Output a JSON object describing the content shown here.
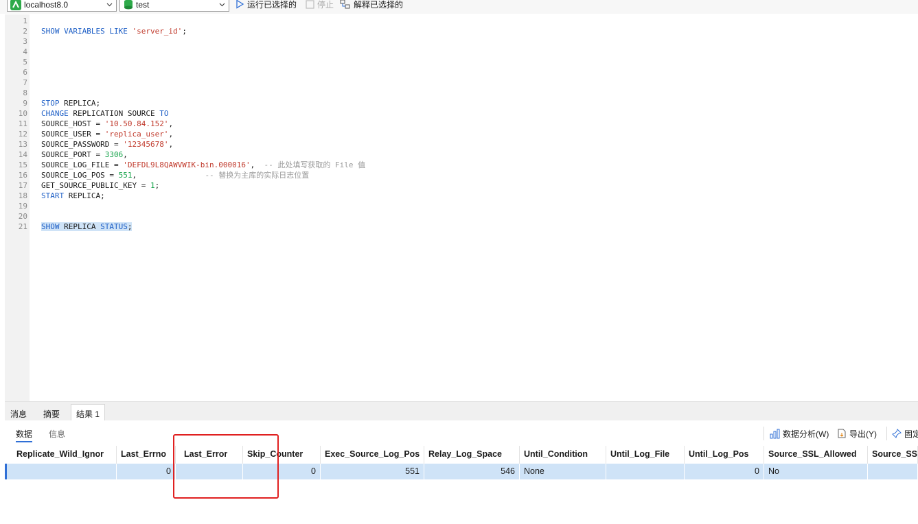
{
  "toolbar": {
    "connection": "localhost8.0",
    "database": "test",
    "run_selected": "运行已选择的",
    "stop": "停止",
    "explain_selected": "解释已选择的"
  },
  "editor": {
    "line_numbers": [
      "1",
      "2",
      "3",
      "4",
      "5",
      "6",
      "7",
      "8",
      "9",
      "10",
      "11",
      "12",
      "13",
      "14",
      "15",
      "16",
      "17",
      "18",
      "19",
      "20",
      "21"
    ],
    "lines": {
      "l2": {
        "kw1": "SHOW VARIABLES LIKE ",
        "str": "'server_id'",
        "end": ";"
      },
      "l9": {
        "kw": "STOP",
        "rest": " REPLICA;"
      },
      "l10": {
        "kw1": "CHANGE",
        "mid": " REPLICATION SOURCE ",
        "kw2": "TO"
      },
      "l11": {
        "pre": "SOURCE_HOST = ",
        "str": "'10.50.84.152'",
        "end": ","
      },
      "l12": {
        "pre": "SOURCE_USER = ",
        "str": "'replica_user'",
        "end": ","
      },
      "l13": {
        "pre": "SOURCE_PASSWORD = ",
        "str": "'12345678'",
        "end": ","
      },
      "l14": {
        "pre": "SOURCE_PORT = ",
        "num": "3306",
        "end": ","
      },
      "l15": {
        "pre": "SOURCE_LOG_FILE = ",
        "str": "'DEFDL9L8QAWVWIK-bin.000016'",
        "end": ",  ",
        "cmt": "-- 此处填写获取的 File 值"
      },
      "l16": {
        "pre": "SOURCE_LOG_POS = ",
        "num": "551",
        "end": ",               ",
        "cmt": "-- 替换为主库的实际日志位置"
      },
      "l17": {
        "pre": "GET_SOURCE_PUBLIC_KEY = ",
        "num": "1",
        "end": ";"
      },
      "l18": {
        "kw": "START",
        "rest": " REPLICA;"
      },
      "l21": {
        "kw": "SHOW",
        "mid": " REPLICA ",
        "kw2": "STATUS",
        "end": ";"
      }
    }
  },
  "result_tabs": [
    "消息",
    "摘要",
    "结果 1"
  ],
  "sub_tabs": [
    "数据",
    "信息"
  ],
  "result_actions": {
    "analyze": "数据分析(W)",
    "export": "导出(Y)",
    "pin": "固定"
  },
  "grid": {
    "columns": [
      "Replicate_Wild_Ignor",
      "Last_Errno",
      "Last_Error",
      "Skip_Counter",
      "Exec_Source_Log_Pos",
      "Relay_Log_Space",
      "Until_Condition",
      "Until_Log_File",
      "Until_Log_Pos",
      "Source_SSL_Allowed",
      "Source_SS"
    ],
    "row": [
      "",
      "0",
      "",
      "0",
      "551",
      "546",
      "None",
      "",
      "0",
      "No",
      ""
    ]
  },
  "colors": {
    "accent": "#2f6fd6",
    "keyword": "#1e5fc6",
    "string": "#c0392b",
    "number": "#15a34a",
    "selection": "#cfe3f7",
    "highlight_box": "#e02020"
  }
}
